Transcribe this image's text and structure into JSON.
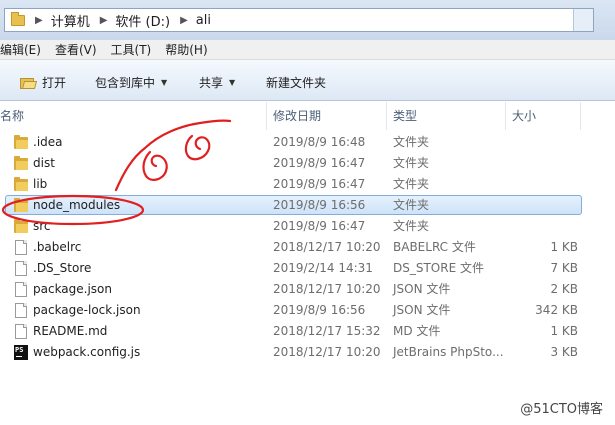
{
  "address": {
    "crumbs": [
      "计算机",
      "软件 (D:)",
      "ali"
    ]
  },
  "menu": {
    "items": [
      "编辑(E)",
      "查看(V)",
      "工具(T)",
      "帮助(H)"
    ]
  },
  "commands": {
    "open": "打开",
    "include_in_library": "包含到库中",
    "share": "共享",
    "new_folder": "新建文件夹"
  },
  "columns": {
    "name": "名称",
    "date": "修改日期",
    "type": "类型",
    "size": "大小"
  },
  "files": [
    {
      "name": ".idea",
      "date": "2019/8/9 16:48",
      "type": "文件夹",
      "size": "",
      "icon": "folder"
    },
    {
      "name": "dist",
      "date": "2019/8/9 16:47",
      "type": "文件夹",
      "size": "",
      "icon": "folder"
    },
    {
      "name": "lib",
      "date": "2019/8/9 16:47",
      "type": "文件夹",
      "size": "",
      "icon": "folder"
    },
    {
      "name": "node_modules",
      "date": "2019/8/9 16:56",
      "type": "文件夹",
      "size": "",
      "icon": "folder",
      "selected": true
    },
    {
      "name": "src",
      "date": "2019/8/9 16:47",
      "type": "文件夹",
      "size": "",
      "icon": "folder"
    },
    {
      "name": ".babelrc",
      "date": "2018/12/17 10:20",
      "type": "BABELRC 文件",
      "size": "1 KB",
      "icon": "file"
    },
    {
      "name": ".DS_Store",
      "date": "2019/2/14 14:31",
      "type": "DS_STORE 文件",
      "size": "7 KB",
      "icon": "file"
    },
    {
      "name": "package.json",
      "date": "2018/12/17 10:20",
      "type": "JSON 文件",
      "size": "2 KB",
      "icon": "file"
    },
    {
      "name": "package-lock.json",
      "date": "2019/8/9 16:56",
      "type": "JSON 文件",
      "size": "342 KB",
      "icon": "file"
    },
    {
      "name": "README.md",
      "date": "2018/12/17 15:32",
      "type": "MD 文件",
      "size": "1 KB",
      "icon": "file"
    },
    {
      "name": "webpack.config.js",
      "date": "2018/12/17 10:20",
      "type": "JetBrains PhpSto...",
      "size": "3 KB",
      "icon": "phpstorm"
    }
  ],
  "annotation": {
    "color": "#e02020"
  },
  "watermark": "@51CTO博客"
}
